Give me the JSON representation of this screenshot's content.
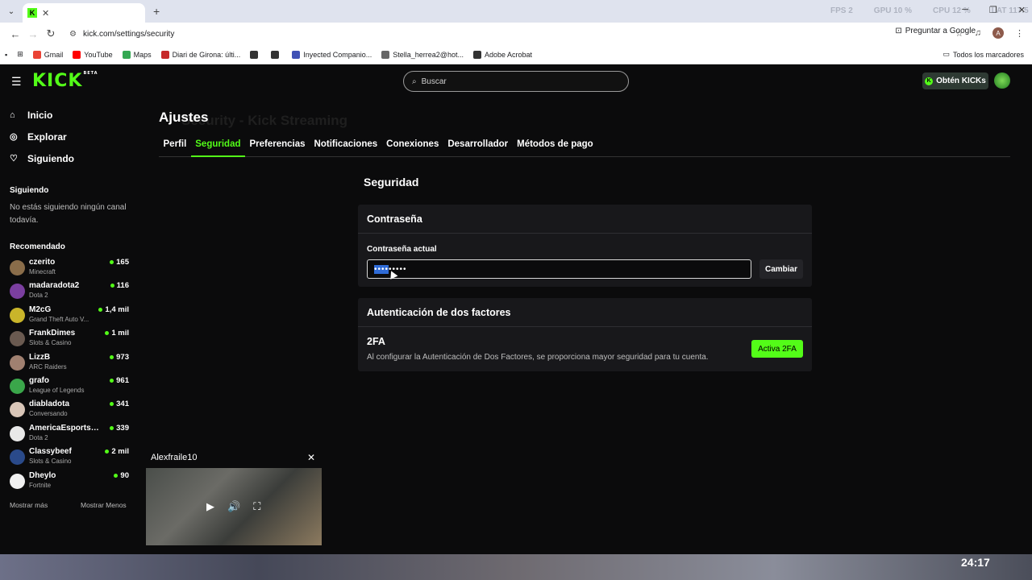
{
  "browser": {
    "tab_title": "Security - Kick Streaming",
    "favicon_letter": "K",
    "url": "kick.com/settings/security",
    "ask_google": "Preguntar a Google",
    "profile_letter": "A",
    "overlay_stats": [
      "FPS 2",
      "GPU 10 %",
      "CPU 12 %",
      "LAT 117.5"
    ],
    "bookmarks": [
      {
        "label": "Gmail",
        "icon": "gmail-icon",
        "color": "#ea4335"
      },
      {
        "label": "YouTube",
        "icon": "youtube-icon",
        "color": "#ff0000"
      },
      {
        "label": "Maps",
        "icon": "maps-icon",
        "color": "#34a853"
      },
      {
        "label": "Diari de Girona: últi...",
        "icon": "news-icon",
        "color": "#c62828"
      },
      {
        "label": "",
        "icon": "globe-icon",
        "color": "#333333"
      },
      {
        "label": "",
        "icon": "globe-icon",
        "color": "#333333"
      },
      {
        "label": "Inyected Companio...",
        "icon": "app-icon",
        "color": "#3f51b5"
      },
      {
        "label": "Stella_herrea2@hot...",
        "icon": "folder-icon",
        "color": "#666666"
      },
      {
        "label": "Adobe Acrobat",
        "icon": "globe-icon",
        "color": "#333333"
      }
    ],
    "all_bookmarks": "Todos los marcadores"
  },
  "header": {
    "logo": "KICK",
    "beta": "BETA",
    "search_placeholder": "Buscar",
    "get_kicks": "Obtén KICKs"
  },
  "sidebar": {
    "nav": [
      {
        "label": "Inicio",
        "icon": "home-icon"
      },
      {
        "label": "Explorar",
        "icon": "compass-icon"
      },
      {
        "label": "Siguiendo",
        "icon": "heart-icon"
      }
    ],
    "following_title": "Siguiendo",
    "following_empty": "No estás siguiendo ningún canal todavía.",
    "recommended_title": "Recomendado",
    "recommended": [
      {
        "name": "czerito",
        "category": "Minecraft",
        "viewers": "165",
        "color": "#8a6d4a"
      },
      {
        "name": "madaradota2",
        "category": "Dota 2",
        "viewers": "116",
        "color": "#7b3fa0"
      },
      {
        "name": "M2cG",
        "category": "Grand Theft Auto V...",
        "viewers": "1,4 mil",
        "color": "#c9b52a"
      },
      {
        "name": "FrankDimes",
        "category": "Slots & Casino",
        "viewers": "1 mil",
        "color": "#6a5a50"
      },
      {
        "name": "LizzB",
        "category": "ARC Raiders",
        "viewers": "973",
        "color": "#a08070"
      },
      {
        "name": "grafo",
        "category": "League of Legends",
        "viewers": "961",
        "color": "#3aa64a"
      },
      {
        "name": "diabladota",
        "category": "Conversando",
        "viewers": "341",
        "color": "#d9c6b8"
      },
      {
        "name": "AmericaEsportsD...",
        "category": "Dota 2",
        "viewers": "339",
        "color": "#e8e8e8"
      },
      {
        "name": "Classybeef",
        "category": "Slots & Casino",
        "viewers": "2 mil",
        "color": "#2a4a8a"
      },
      {
        "name": "Dheylo",
        "category": "Fortnite",
        "viewers": "90",
        "color": "#f0f0f0"
      }
    ],
    "show_more": "Mostrar más",
    "show_less": "Mostrar Menos"
  },
  "settings": {
    "title": "Ajustes",
    "tabs": [
      "Perfil",
      "Seguridad",
      "Preferencias",
      "Notificaciones",
      "Conexiones",
      "Desarrollador",
      "Métodos de pago"
    ],
    "active_tab": "Seguridad",
    "section_title": "Seguridad",
    "password": {
      "card_title": "Contraseña",
      "label": "Contraseña actual",
      "value_selected": "••••",
      "value_rest": "•••••",
      "change_button": "Cambiar"
    },
    "twofa": {
      "card_title": "Autenticación de dos factores",
      "heading": "2FA",
      "description": "Al configurar la Autenticación de Dos Factores, se proporciona mayor seguridad para tu cuenta.",
      "button": "Activa 2FA"
    }
  },
  "mini_player": {
    "channel": "Alexfraile10"
  },
  "desktop": {
    "clock": "24:17"
  }
}
